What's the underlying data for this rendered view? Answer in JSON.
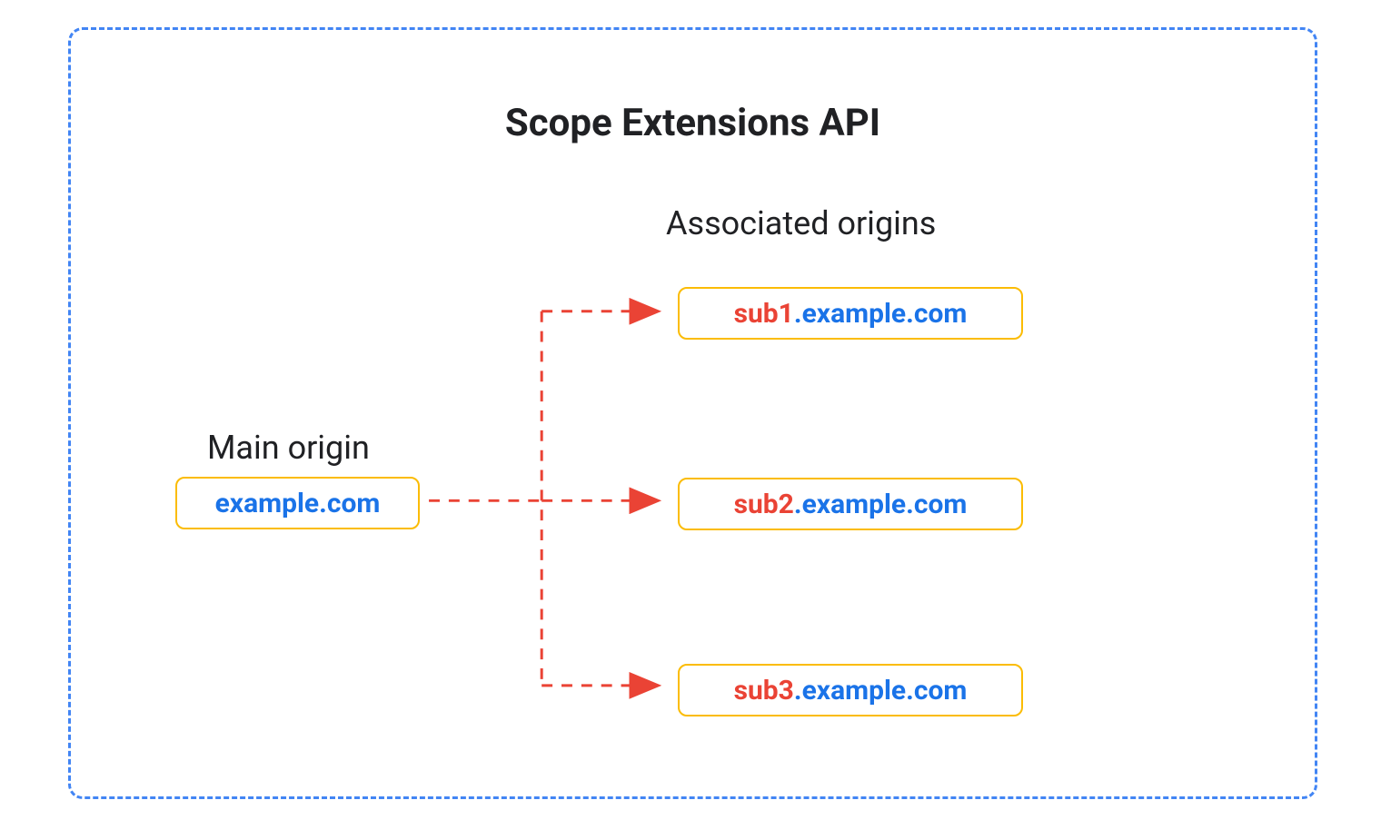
{
  "title": "Scope Extensions API",
  "mainOrigin": {
    "label": "Main origin",
    "domain": "example.com"
  },
  "associatedOrigins": {
    "label": "Associated origins",
    "items": [
      {
        "subdomain": "sub1",
        "domain": ".example.com"
      },
      {
        "subdomain": "sub2",
        "domain": ".example.com"
      },
      {
        "subdomain": "sub3",
        "domain": ".example.com"
      }
    ]
  },
  "colors": {
    "border": "#4285f4",
    "boxBorder": "#fbbc04",
    "blue": "#1a73e8",
    "red": "#ea4335",
    "arrow": "#ea4335"
  }
}
